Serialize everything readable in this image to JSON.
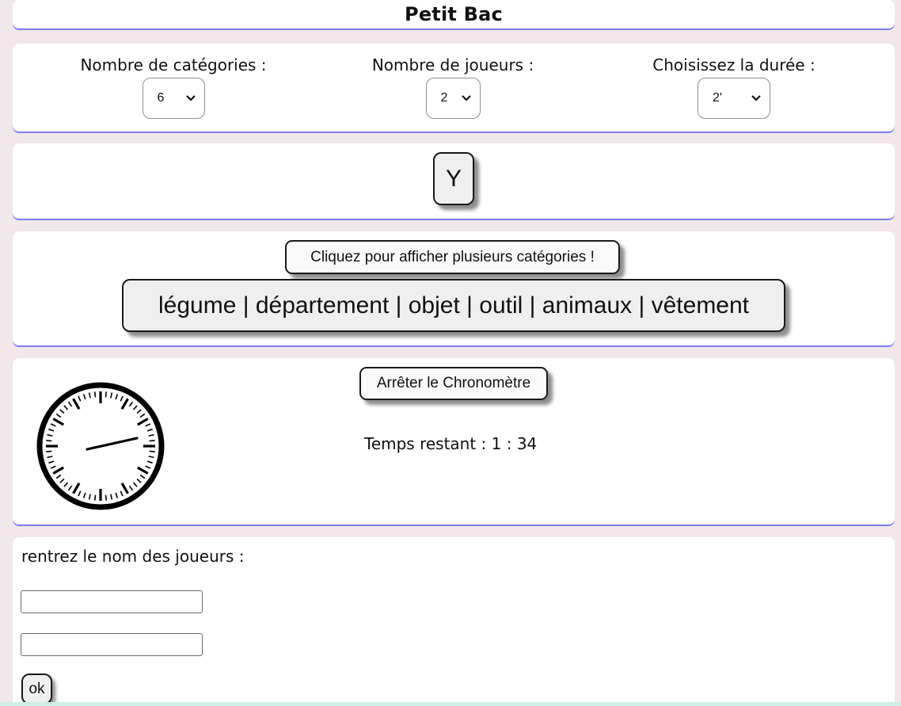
{
  "header": {
    "title": "Petit Bac"
  },
  "settings": {
    "categories": {
      "label": "Nombre de catégories :",
      "selected": "6"
    },
    "players": {
      "label": "Nombre de joueurs :",
      "selected": "2"
    },
    "duration": {
      "label": "Choisissez la durée :",
      "selected": "2'"
    }
  },
  "letter": {
    "value": "Y"
  },
  "categories": {
    "button_label": "Cliquez pour afficher plusieurs catégories !",
    "display": "légume | département | objet | outil | animaux | vêtement"
  },
  "timer": {
    "stop_label": "Arrêter le Chronomètre",
    "remaining": "Temps restant : 1 : 34",
    "icon": "clock-icon"
  },
  "players": {
    "prompt": "rentrez le nom des joueurs :",
    "player_1_value": "",
    "player_2_value": "",
    "ok_label": "ok"
  },
  "colors": {
    "background": "#f2e7ea",
    "card": "#ffffff",
    "card_border": "#6f6cf0",
    "button": "#efefef"
  }
}
